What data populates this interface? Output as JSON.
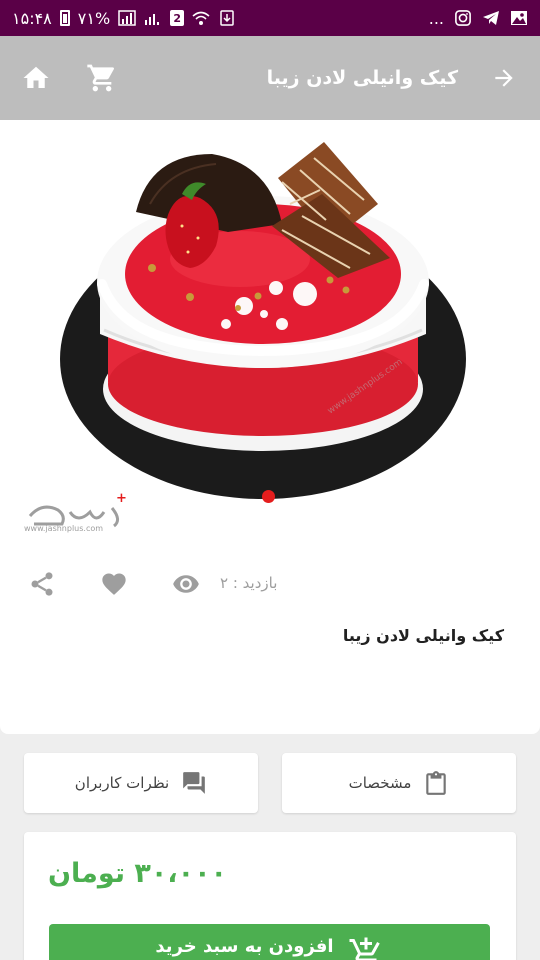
{
  "status_bar": {
    "time": "۱۵:۴۸",
    "battery": "۷۱%",
    "sim_slot": "2",
    "overflow": "..."
  },
  "toolbar": {
    "title": "کیک وانیلی لادن زیبا",
    "back_icon": "arrow-right-icon",
    "cart_icon": "cart-icon",
    "home_icon": "home-icon"
  },
  "product": {
    "watermark_url": "www.jashnplus.com",
    "view_label": "بازدید : ۲",
    "name": "کیک وانیلی لادن زیبا"
  },
  "tabs": {
    "specs_label": "مشخصات",
    "reviews_label": "نظرات کاربران"
  },
  "purchase": {
    "price": "۳۰،۰۰۰ تومان",
    "add_to_cart_label": "افزودن به سبد خرید"
  },
  "colors": {
    "status_bar": "#5a0047",
    "toolbar": "#bdbdbd",
    "accent_green": "#4caf50",
    "indicator_red": "#e41d1d"
  }
}
